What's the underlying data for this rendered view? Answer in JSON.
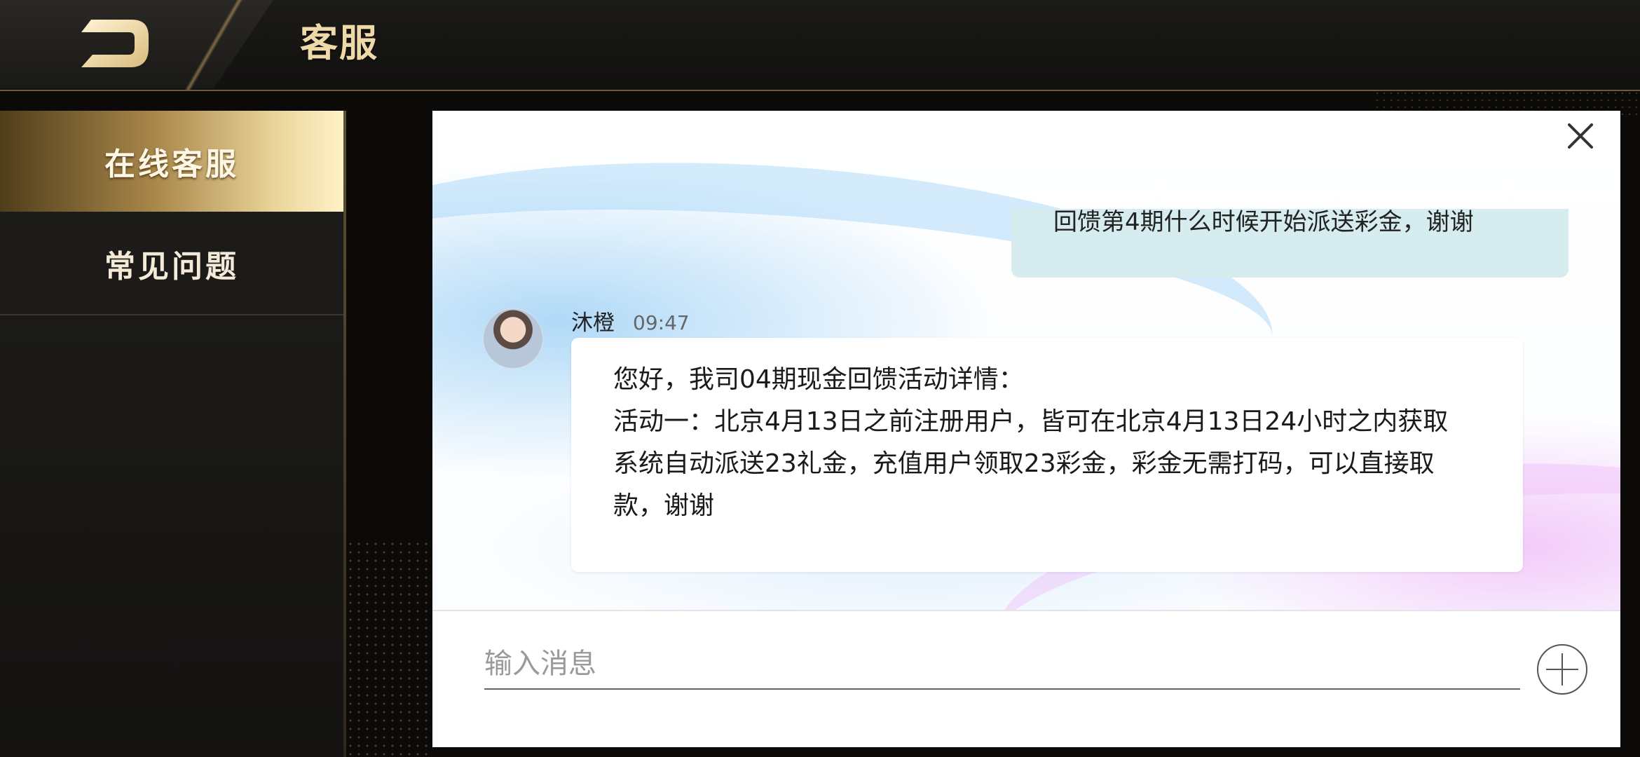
{
  "header": {
    "title": "客服",
    "back_icon": "back-arrow-icon"
  },
  "sidebar": {
    "items": [
      {
        "label": "在线客服",
        "active": true
      },
      {
        "label": "常见问题",
        "active": false
      }
    ]
  },
  "chat": {
    "close_icon": "close-icon",
    "outgoing_partial": "回馈第4期什么时候开始派送彩金，谢谢",
    "incoming": {
      "sender": "沐橙",
      "time": "09:47",
      "lines": [
        "您好，我司04期现金回馈活动详情：",
        "活动一：北京4月13日之前注册用户，皆可在北京4月13日24小时之内获取",
        "系统自动派送23礼金，充值用户领取23彩金，彩金无需打码，可以直接取",
        "款，谢谢"
      ]
    },
    "input": {
      "placeholder": "输入消息",
      "value": ""
    },
    "add_icon": "plus-circle-icon"
  },
  "colors": {
    "accent_gold": "#efd9a8",
    "bubble_out": "#d6ecee",
    "bubble_in": "#ffffff"
  }
}
